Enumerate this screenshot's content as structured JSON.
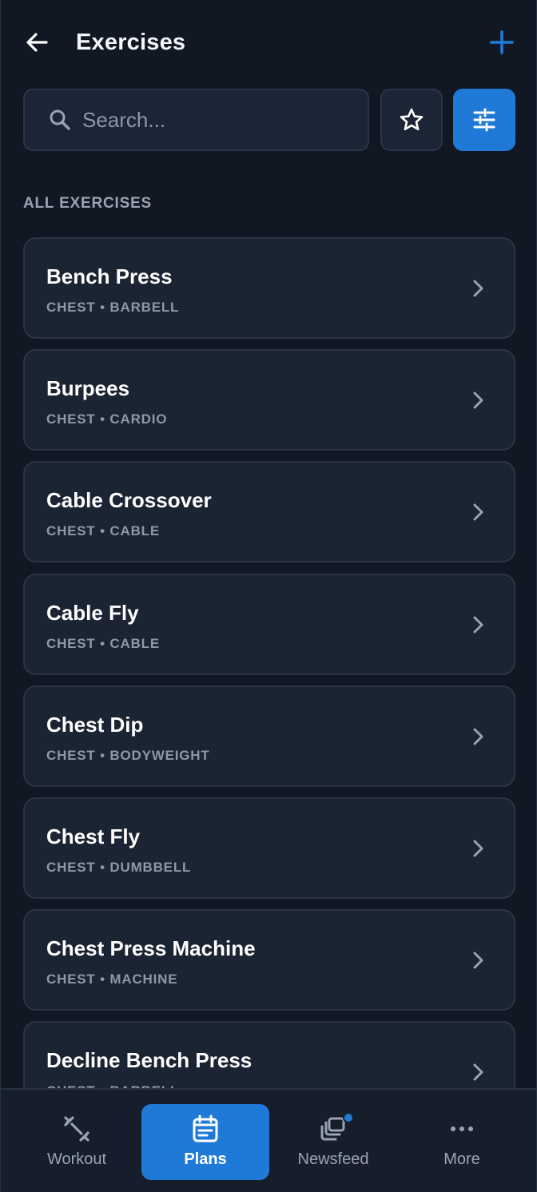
{
  "header": {
    "title": "Exercises"
  },
  "search": {
    "placeholder": "Search..."
  },
  "section": {
    "label": "ALL EXERCISES"
  },
  "exercises": [
    {
      "name": "Bench Press",
      "meta": "CHEST • BARBELL"
    },
    {
      "name": "Burpees",
      "meta": "CHEST • CARDIO"
    },
    {
      "name": "Cable Crossover",
      "meta": "CHEST • CABLE"
    },
    {
      "name": "Cable Fly",
      "meta": "CHEST • CABLE"
    },
    {
      "name": "Chest Dip",
      "meta": "CHEST • BODYWEIGHT"
    },
    {
      "name": "Chest Fly",
      "meta": "CHEST • DUMBBELL"
    },
    {
      "name": "Chest Press Machine",
      "meta": "CHEST • MACHINE"
    },
    {
      "name": "Decline Bench Press",
      "meta": "CHEST • BARBELL"
    }
  ],
  "nav": {
    "items": [
      {
        "label": "Workout",
        "icon": "dumbbell-icon",
        "active": false
      },
      {
        "label": "Plans",
        "icon": "calendar-icon",
        "active": true
      },
      {
        "label": "Newsfeed",
        "icon": "newsfeed-icon",
        "active": false,
        "badge": true
      },
      {
        "label": "More",
        "icon": "more-icon",
        "active": false
      }
    ]
  },
  "colors": {
    "background": "#111823",
    "card": "#1b2433",
    "accent": "#1f7ad7",
    "muted_text": "#8f98a8"
  }
}
